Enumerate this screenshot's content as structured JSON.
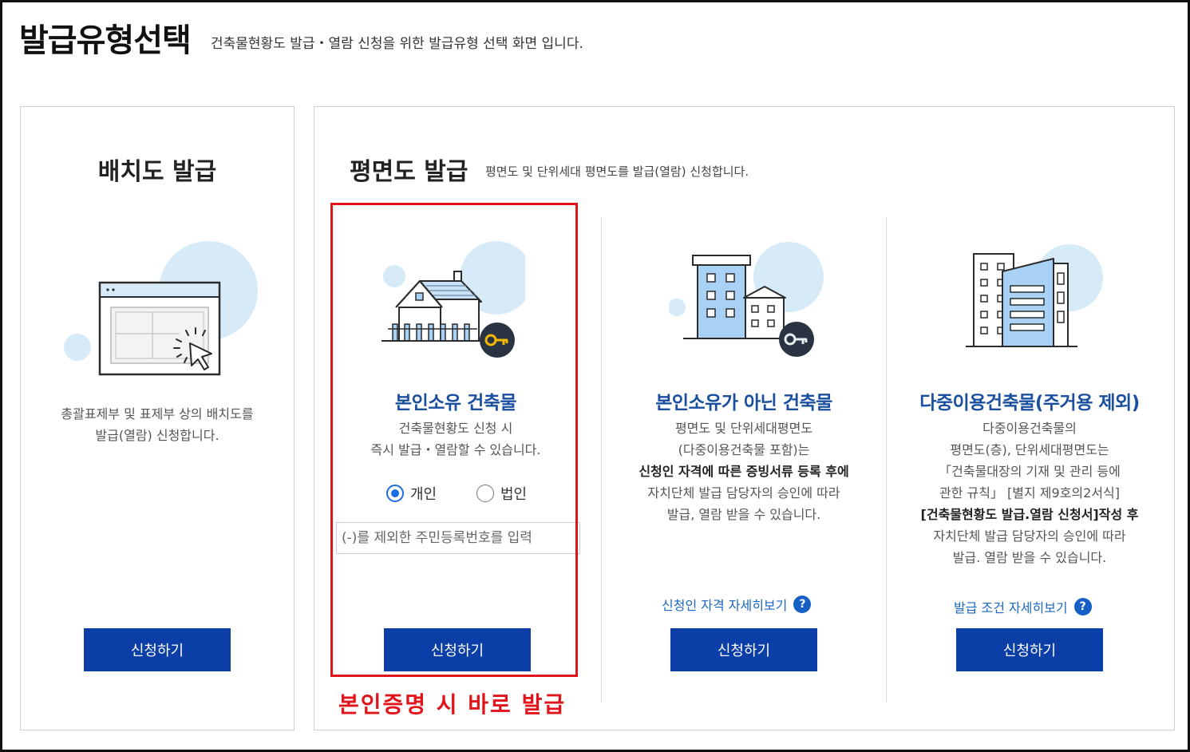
{
  "header": {
    "title": "발급유형선택",
    "subtitle": "건축물현황도 발급・열람 신청을 위한 발급유형 선택 화면 입니다."
  },
  "left_panel": {
    "title": "배치도 발급",
    "desc_line1": "총괄표제부 및 표제부 상의 배치도를",
    "desc_line2": "발급(열람) 신청합니다.",
    "button_label": "신청하기"
  },
  "right_panel": {
    "title": "평면도 발급",
    "desc": "평면도 및 단위세대 평면도를 발급(열람) 신청합니다.",
    "cards": [
      {
        "title": "본인소유 건축물",
        "desc_line1": "건축물현황도 신청 시",
        "desc_line2": "즉시 발급・열람할 수 있습니다.",
        "radio_personal": "개인",
        "radio_corporate": "법인",
        "input_placeholder": "(-)를 제외한 주민등록번호를 입력",
        "button_label": "신청하기"
      },
      {
        "title": "본인소유가 아닌 건축물",
        "desc_line1": "평면도 및 단위세대평면도",
        "desc_line2": "(다중이용건축물 포함)는",
        "desc_bold": "신청인 자격에 따른 증빙서류 등록 후에",
        "desc_line3": "자치단체 발급 담당자의 승인에 따라",
        "desc_line4": "발급, 열람 받을 수 있습니다.",
        "link_label": "신청인 자격 자세히보기",
        "button_label": "신청하기"
      },
      {
        "title": "다중이용건축물(주거용 제외)",
        "desc_line1": "다중이용건축물의",
        "desc_line2": "평면도(층), 단위세대평면도는",
        "desc_line3": "「건축물대장의 기재 및 관리 등에",
        "desc_line4": "관한 규칙」 [별지 제9호의2서식]",
        "desc_bold": "[건축물현황도 발급.열람 신청서]작성 후",
        "desc_line5": "자치단체 발급 담당자의 승인에 따라",
        "desc_line6": "발급. 열람 받을 수 있습니다.",
        "link_label": "발급 조건 자세히보기",
        "button_label": "신청하기"
      }
    ]
  },
  "annotation": {
    "note": "본인증명 시 바로 발급"
  },
  "help_icon_glyph": "?",
  "colors": {
    "primary_button": "#0b3ea6",
    "card_title": "#1a4fa0",
    "highlight": "#e0141b",
    "radio_selected": "#1a6fe0",
    "illustration_circle": "#d6eaf8",
    "building_fill": "#a9d0f5",
    "key_badge": "#2a3342",
    "key_color": "#f2b705"
  },
  "icons": [
    "cursor-window-icon",
    "house-key-icon",
    "building-key-icon",
    "multi-building-icon",
    "help-icon"
  ]
}
